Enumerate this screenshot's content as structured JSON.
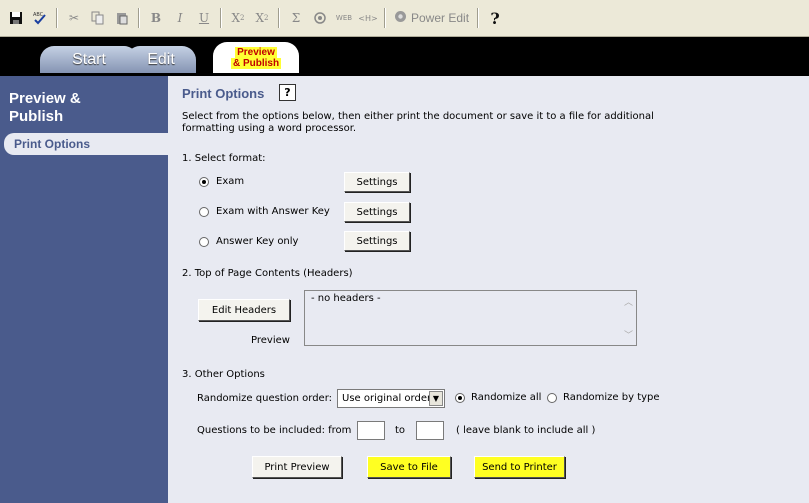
{
  "toolbar": {
    "power_edit_label": "Power Edit"
  },
  "tabs": {
    "start": "Start",
    "edit": "Edit",
    "preview_line1": "Preview",
    "preview_line2": "& Publish"
  },
  "sidebar": {
    "title_line1": "Preview &",
    "title_line2": "Publish",
    "item": "Print Options"
  },
  "main": {
    "heading": "Print Options",
    "help_glyph": "?",
    "description": "Select from the options below, then either print the document or save it to a file for additional formatting using a word processor.",
    "section1": "1.  Select format:",
    "formats": [
      {
        "label": "Exam",
        "selected": true,
        "settings": "Settings"
      },
      {
        "label": "Exam with Answer Key",
        "selected": false,
        "settings": "Settings"
      },
      {
        "label": "Answer Key only",
        "selected": false,
        "settings": "Settings"
      }
    ],
    "section2": "2.  Top of Page Contents (Headers)",
    "edit_headers": "Edit Headers",
    "preview_label": "Preview",
    "headers_text": "- no headers -",
    "section3": "3.  Other Options",
    "randomize_label": "Randomize question order:",
    "order_value": "Use original order",
    "randomize_all": "Randomize all",
    "randomize_by_type": "Randomize by type",
    "randomize_selected": "all",
    "questions_label": "Questions to be included:  from",
    "to_label": "to",
    "from_value": "",
    "to_value": "",
    "blank_hint": "( leave blank to include all )",
    "print_preview": "Print Preview",
    "save_to_file": "Save to File",
    "send_to_printer": "Send to Printer"
  },
  "colors": {
    "sidebar": "#4a5b8c",
    "pane": "#e8eaf2",
    "highlight": "#ffff22",
    "heading": "#4a5b8c"
  }
}
